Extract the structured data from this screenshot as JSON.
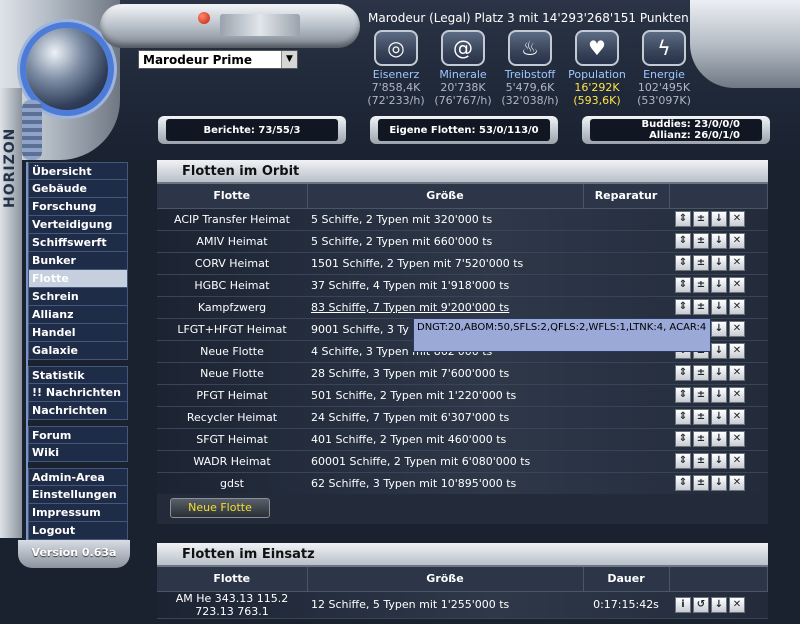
{
  "header": {
    "title": "Marodeur (Legal) Platz 3 mit 14'293'268'151 Punkten",
    "planet_select": "Marodeur Prime",
    "brand": "HORIZON"
  },
  "resources": [
    {
      "label": "Eisenerz",
      "amount": "7'858,4K",
      "rate": "(72'233/h)",
      "icon": "gear-icon",
      "highlight": false
    },
    {
      "label": "Minerale",
      "amount": "20'738K",
      "rate": "(76'767/h)",
      "icon": "spiral-icon",
      "highlight": false
    },
    {
      "label": "Treibstoff",
      "amount": "5'479,6K",
      "rate": "(32'038/h)",
      "icon": "flame-icon",
      "highlight": false
    },
    {
      "label": "Population",
      "amount": "16'292K",
      "rate": "(593,6K)",
      "icon": "heart-icon",
      "highlight": true
    },
    {
      "label": "Energie",
      "amount": "102'495K",
      "rate": "(53'097K)",
      "icon": "lightning-icon",
      "highlight": false
    }
  ],
  "top_boxes": {
    "berichte": "Berichte: 73/55/3",
    "flotten": "Eigene Flotten: 53/0/113/0",
    "buddies": "Buddies: 23/0/0/0",
    "allianz": "Allianz: 26/0/1/0"
  },
  "nav": {
    "group1": [
      "Übersicht",
      "Gebäude",
      "Forschung",
      "Verteidigung",
      "Schiffswerft",
      "Bunker",
      "Flotte",
      "Schrein",
      "Allianz",
      "Handel",
      "Galaxie"
    ],
    "group2": [
      "Statistik",
      "!! Nachrichten",
      "Nachrichten"
    ],
    "group3": [
      "Forum",
      "Wiki"
    ],
    "group4": [
      "Admin-Area",
      "Einstellungen",
      "Impressum",
      "Logout"
    ],
    "active": "Flotte",
    "version": "Version 0.63a"
  },
  "orbit": {
    "title": "Flotten im Orbit",
    "headers": [
      "Flotte",
      "Größe",
      "Reparatur",
      ""
    ],
    "rows": [
      {
        "name": "ACIP Transfer Heimat",
        "size": "5 Schiffe, 2 Typen mit 320'000 ts"
      },
      {
        "name": "AMIV Heimat",
        "size": "5 Schiffe, 2 Typen mit 660'000 ts"
      },
      {
        "name": "CORV Heimat",
        "size": "1501 Schiffe, 2 Typen mit 7'520'000 ts"
      },
      {
        "name": "HGBC Heimat",
        "size": "37 Schiffe, 4 Typen mit 1'918'000 ts"
      },
      {
        "name": "Kampfzwerg",
        "size": "83 Schiffe, 7 Typen mit 9'200'000 ts"
      },
      {
        "name": "LFGT+HFGT Heimat",
        "size": "9001 Schiffe, 3 Ty"
      },
      {
        "name": "Neue Flotte",
        "size": "4 Schiffe, 3 Typen mit 862'000 ts"
      },
      {
        "name": "Neue Flotte",
        "size": "28 Schiffe, 3 Typen mit 7'600'000 ts"
      },
      {
        "name": "PFGT Heimat",
        "size": "501 Schiffe, 2 Typen mit 1'220'000 ts"
      },
      {
        "name": "Recycler Heimat",
        "size": "24 Schiffe, 7 Typen mit 6'307'000 ts"
      },
      {
        "name": "SFGT Heimat",
        "size": "401 Schiffe, 2 Typen mit 460'000 ts"
      },
      {
        "name": "WADR Heimat",
        "size": "60001 Schiffe, 2 Typen mit 6'080'000 ts"
      },
      {
        "name": "gdst",
        "size": "62 Schiffe, 3 Typen mit 10'895'000 ts"
      }
    ],
    "tooltip": "DNGT:20,ABOM:50,SFLS:2,QFLS:2,WFLS:1,LTNK:4, ACAR:4",
    "new_fleet_button": "Neue Flotte"
  },
  "einsatz": {
    "title": "Flotten im Einsatz",
    "headers": [
      "Flotte",
      "Größe",
      "Dauer",
      ""
    ],
    "rows": [
      {
        "name_line1": "AM He 343.13 115.2",
        "name_line2": "723.13 763.1",
        "size": "12 Schiffe, 5 Typen mit 1'255'000 ts",
        "duration": "0:17:15:42s"
      }
    ]
  }
}
